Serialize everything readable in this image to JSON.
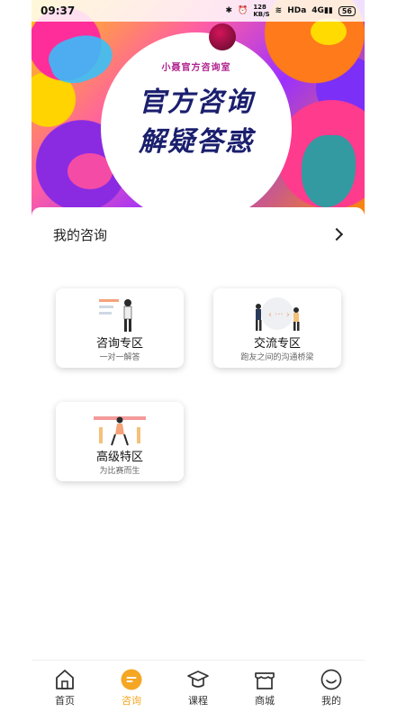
{
  "status_bar": {
    "time": "09:37",
    "network_speed": "128\nKB/S",
    "hd": "HDa",
    "signal": "4G",
    "battery": "56"
  },
  "banner": {
    "subtitle": "小聂官方咨询室",
    "line1": "官方咨询",
    "line2": "解疑答惑"
  },
  "section": {
    "title": "我的咨询"
  },
  "tiles": [
    {
      "title": "咨询专区",
      "subtitle": "一对一解答"
    },
    {
      "title": "交流专区",
      "subtitle": "跑友之间的沟通桥梁"
    },
    {
      "title": "高级特区",
      "subtitle": "为比赛而生"
    }
  ],
  "bottom_nav": {
    "items": [
      {
        "label": "首页",
        "icon": "home-icon",
        "active": false
      },
      {
        "label": "咨询",
        "icon": "chat-icon",
        "active": true
      },
      {
        "label": "课程",
        "icon": "graduation-cap-icon",
        "active": false
      },
      {
        "label": "商城",
        "icon": "store-icon",
        "active": false
      },
      {
        "label": "我的",
        "icon": "smiley-face-icon",
        "active": false
      }
    ],
    "active_color": "#f5a623",
    "inactive_color": "#333333"
  }
}
